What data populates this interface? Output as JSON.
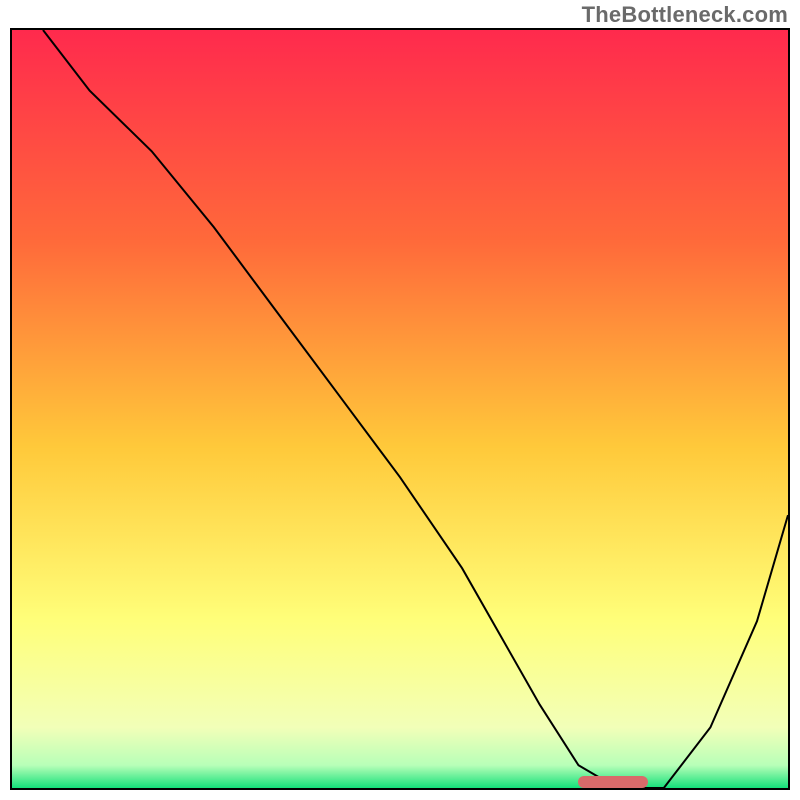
{
  "watermark": "TheBottleneck.com",
  "chart_data": {
    "type": "line",
    "title": "",
    "xlabel": "",
    "ylabel": "",
    "x_range": [
      0,
      100
    ],
    "y_range": [
      0,
      100
    ],
    "background_gradient": {
      "stops": [
        {
          "pct": 0,
          "color": "#ff2a4d"
        },
        {
          "pct": 28,
          "color": "#ff6a3a"
        },
        {
          "pct": 55,
          "color": "#ffc93a"
        },
        {
          "pct": 78,
          "color": "#ffff7a"
        },
        {
          "pct": 92,
          "color": "#f2ffb8"
        },
        {
          "pct": 97,
          "color": "#b8ffb8"
        },
        {
          "pct": 100,
          "color": "#14e07a"
        }
      ]
    },
    "series": [
      {
        "name": "bottleneck-curve",
        "color": "#000000",
        "stroke_width": 2,
        "x": [
          4,
          10,
          18,
          26,
          34,
          42,
          50,
          58,
          63,
          68,
          73,
          78,
          84,
          90,
          96,
          100
        ],
        "y": [
          100,
          92,
          84,
          74,
          63,
          52,
          41,
          29,
          20,
          11,
          3,
          0,
          0,
          8,
          22,
          36
        ]
      }
    ],
    "marker": {
      "name": "optimal-range",
      "color": "#d96a6a",
      "x_start": 73,
      "x_end": 82,
      "y": 0
    }
  }
}
